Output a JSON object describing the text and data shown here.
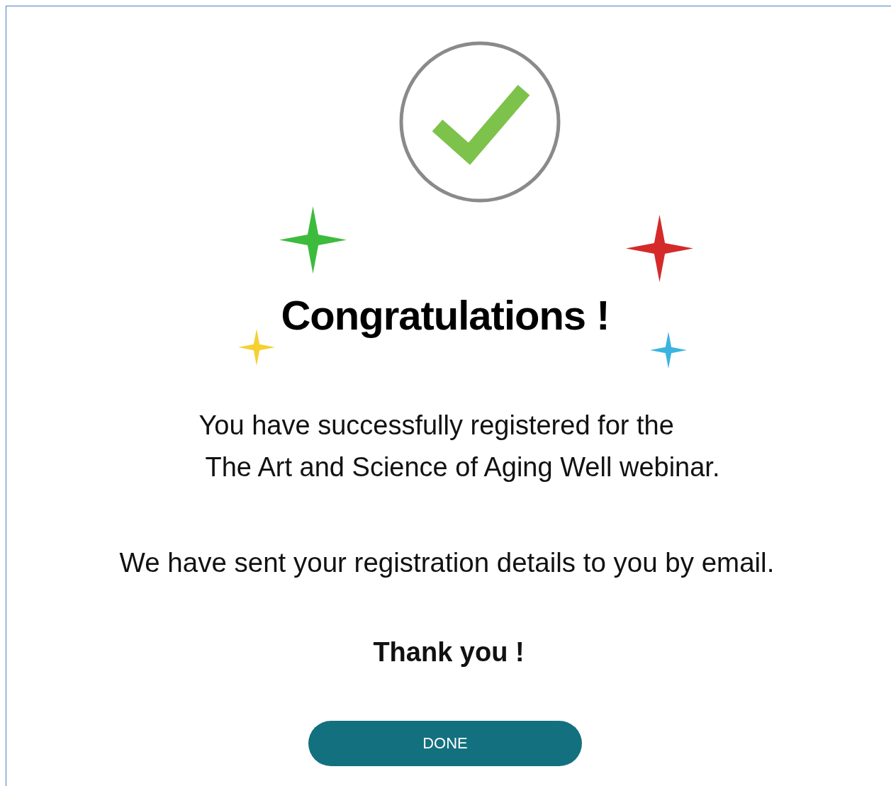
{
  "title": "Congratulations !",
  "message_lines": [
    "You have successfully registered for the",
    "The Art and Science of Aging Well webinar."
  ],
  "email_note": "We have sent your registration details to you by email.",
  "thanks": "Thank you !",
  "button": {
    "label": "DONE"
  },
  "sparkles": [
    {
      "color": "#3dbb3d"
    },
    {
      "color": "#d42a2a"
    },
    {
      "color": "#f5d031"
    },
    {
      "color": "#3cb4e0"
    }
  ]
}
